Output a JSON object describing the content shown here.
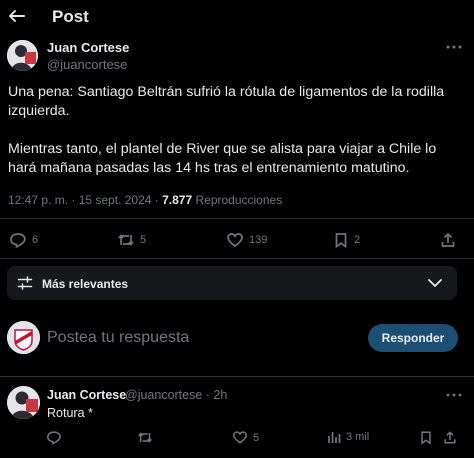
{
  "header": {
    "title": "Post",
    "back_icon": "arrow-left-icon"
  },
  "post": {
    "author_name": "Juan Cortese",
    "author_handle": "@juancortese",
    "text": "Una pena: Santiago Beltrán sufrió la rótula de ligamentos de la rodilla izquierda.\n\nMientras tanto, el plantel de River que se alista para viajar a Chile lo hará mañana pasadas las 14 hs tras el entrenamiento matutino.",
    "timestamp": "12:47 p. m. · 15 sept. 2024 ·",
    "views_count": "7.877",
    "views_label": "Reproducciones",
    "replies": "6",
    "reposts": "5",
    "likes": "139",
    "bookmarks": "2"
  },
  "sort": {
    "label": "Más relevantes"
  },
  "compose": {
    "placeholder": "Postea tu respuesta",
    "button": "Responder"
  },
  "reply": {
    "author_name": "Juan Cortese",
    "meta": "@juancortese · 2h",
    "text": "Rotura *",
    "likes": "5",
    "views": "3 mil"
  },
  "colors": {
    "background": "#000000",
    "text": "#e7e9ea",
    "muted": "#71767b",
    "accent_button": "#1d4f72",
    "divider": "#2f3336"
  }
}
